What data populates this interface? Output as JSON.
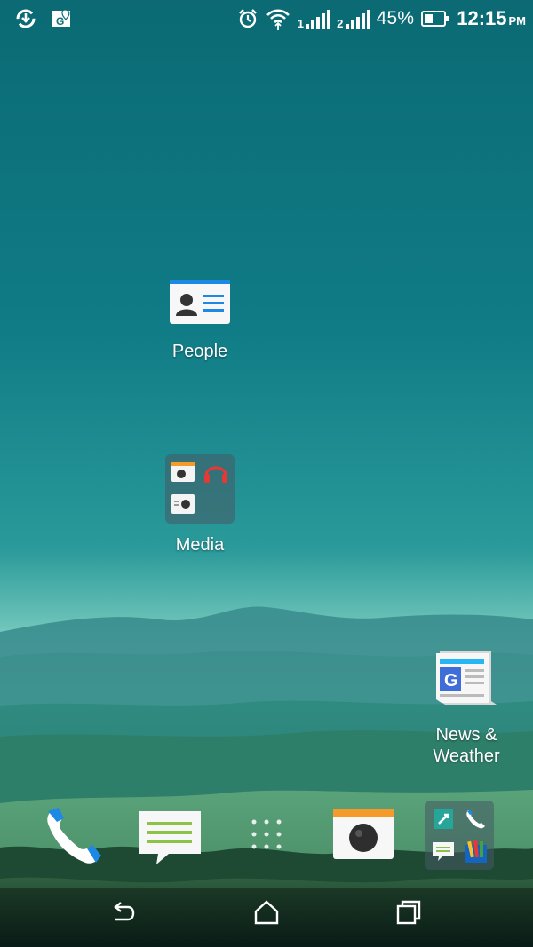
{
  "status_bar": {
    "left_icons": [
      "sync-icon",
      "maps-icon"
    ],
    "right_icons": [
      "alarm-icon",
      "wifi-icon",
      "signal-1-icon",
      "signal-2-icon",
      "battery-icon"
    ],
    "sim1_label": "1",
    "sim2_label": "2",
    "battery_percent": "45%",
    "battery_level": 0.45,
    "time": "12:15",
    "ampm": "PM"
  },
  "home": {
    "apps": [
      {
        "label": "People",
        "icon": "people-icon"
      },
      {
        "label": "Media",
        "icon": "media-folder-icon"
      },
      {
        "label_line1": "News &",
        "label_line2": "Weather",
        "icon": "news-weather-icon"
      }
    ]
  },
  "dock": {
    "items": [
      "phone-icon",
      "messages-icon",
      "app-drawer-icon",
      "camera-icon",
      "apps-folder-icon"
    ]
  },
  "nav_bar": {
    "buttons": [
      "back-icon",
      "home-icon",
      "recents-icon"
    ]
  }
}
